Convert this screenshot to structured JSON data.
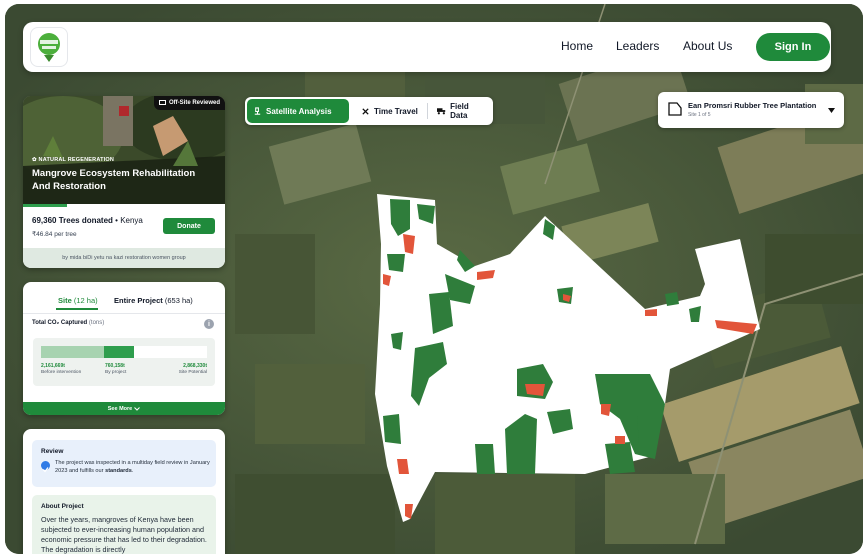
{
  "nav": {
    "logo_alt": "Plant for the Planet",
    "links": [
      "Home",
      "Leaders",
      "About Us"
    ],
    "signin_label": "Sign In"
  },
  "map_tabs": {
    "satellite": "Satellite Analysis",
    "time_travel": "Time Travel",
    "field_data": "Field Data"
  },
  "site_selector": {
    "name": "Ean Promsri Rubber Tree Plantation",
    "sub": "Site 1 of 5"
  },
  "project": {
    "badge": "Off-Site Reviewed",
    "classification": "NATURAL REGENERATION",
    "title": "Mangrove Ecosystem Rehabilitation And Restoration",
    "trees_donated": "69,360 Trees donated",
    "separator": " • ",
    "country": "Kenya",
    "price": "₹46.84 per tree",
    "donate_label": "Donate",
    "byline": "by mida biDi yetu na kazi restoration women group"
  },
  "co2": {
    "tab_site_label": "Site",
    "tab_site_area": "(12 ha)",
    "tab_entire_label": "Entire Project",
    "tab_entire_area": "(653 ha)",
    "heading": "Total CO₂ Captured",
    "unit": "(tons)",
    "info_icon": "info-icon",
    "before_value": "2,161,669t",
    "before_label": "Before intervention",
    "project_value": "760,158t",
    "project_label": "By project",
    "potential_value": "2,868,330t",
    "potential_label": "Site Potential",
    "bar_before_fraction": 0.38,
    "bar_project_fraction": 0.18,
    "see_more": "See More"
  },
  "review": {
    "title": "Review",
    "text_prefix": "The project was inspected in a multiday field review in January 2023 and fulfills our ",
    "text_link": "standards",
    "text_suffix": "."
  },
  "about": {
    "title": "About Project",
    "text": "Over the years, mangroves of Kenya have been subjected to ever-increasing human population and economic pressure that has led to their degradation. The degradation is directly"
  },
  "colors": {
    "brand_green": "#1f8a3b",
    "accent_green": "#2e9e4d",
    "vegetation": "#2f7d3b",
    "loss_red": "#e2553a",
    "review_bg": "#e8f0fb",
    "about_bg": "#e9f3ea"
  }
}
